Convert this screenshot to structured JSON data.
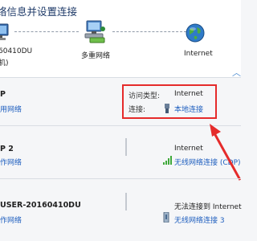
{
  "header": {
    "title": "络信息并设置连接"
  },
  "map": {
    "computer_name": "60410DU",
    "computer_sub": "机)",
    "middle_label": "多重网络",
    "internet_label": "Internet"
  },
  "networks": [
    {
      "name": "P",
      "type": "用网络",
      "access_label": "访问类型:",
      "access_value": "Internet",
      "conn_label": "连接:",
      "conn_value": "本地连接"
    },
    {
      "name": "P 2",
      "type": "作网络",
      "access_value": "Internet",
      "conn_value": "无线网络连接 (CDP)"
    },
    {
      "name": "USER-20160410DU",
      "type": "作网络",
      "access_value": "无法连接到 Internet",
      "conn_value": "无线网络连接 3"
    }
  ],
  "colors": {
    "highlight": "#e52b2b",
    "link": "#1f5fbf"
  }
}
